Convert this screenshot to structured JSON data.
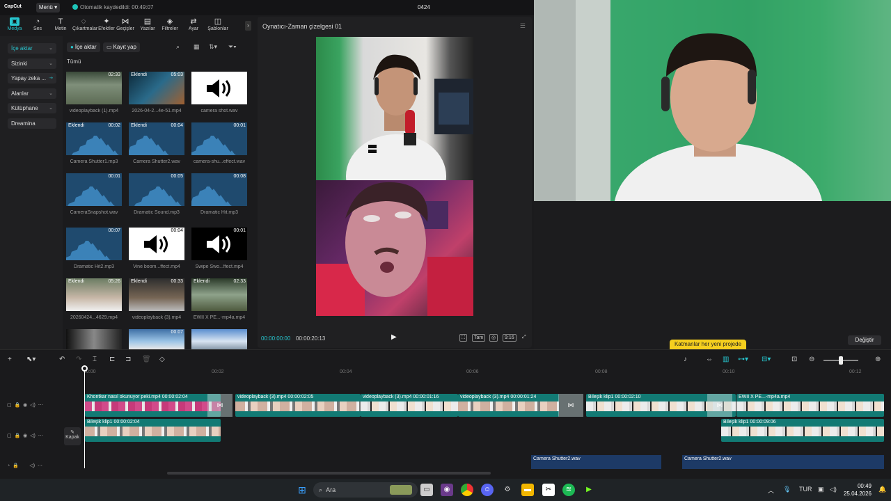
{
  "app": {
    "logo": "CapCut",
    "menu_label": "Menü",
    "autosave": "Otomatik kaydedildi: 00:49:07",
    "project_title": "0424"
  },
  "toolbar": {
    "items": [
      {
        "label": "Medya",
        "icon": "media-icon",
        "glyph": "▣"
      },
      {
        "label": "Ses",
        "icon": "audio-icon",
        "glyph": "◔"
      },
      {
        "label": "Metin",
        "icon": "text-icon",
        "glyph": "T"
      },
      {
        "label": "Çıkartmalar",
        "icon": "sticker-icon",
        "glyph": "◌"
      },
      {
        "label": "Efektler",
        "icon": "effects-icon",
        "glyph": "✦"
      },
      {
        "label": "Geçişler",
        "icon": "transitions-icon",
        "glyph": "⋈"
      },
      {
        "label": "Yazılar",
        "icon": "captions-icon",
        "glyph": "▤"
      },
      {
        "label": "Filtreler",
        "icon": "filters-icon",
        "glyph": "◈"
      },
      {
        "label": "Ayar",
        "icon": "adjust-icon",
        "glyph": "⇄"
      },
      {
        "label": "Şablonlar",
        "icon": "templates-icon",
        "glyph": "◫"
      }
    ]
  },
  "leftnav": {
    "items": [
      {
        "label": "İçe aktar"
      },
      {
        "label": "Sizinki"
      },
      {
        "label": "Yapay zeka ..."
      },
      {
        "label": "Alanlar"
      },
      {
        "label": "Kütüphane"
      },
      {
        "label": "Dreamina"
      }
    ]
  },
  "media": {
    "import_label": "İçe aktar",
    "record_label": "Kayıt yap",
    "all_label": "Tümü",
    "items": [
      {
        "name": "videoplayback (1).mp4",
        "duration": "02:33",
        "tag": "",
        "kind": "video1"
      },
      {
        "name": "2026-04-2...4e-51.mp4",
        "duration": "05:03",
        "tag": "Eklendi",
        "kind": "video2"
      },
      {
        "name": "camera shot.wav",
        "duration": "",
        "tag": "",
        "kind": "spk"
      },
      {
        "name": "Camera Shutter1.mp3",
        "duration": "00:02",
        "tag": "Eklendi",
        "kind": "wave"
      },
      {
        "name": "Camera Shutter2.wav",
        "duration": "00:04",
        "tag": "Eklendi",
        "kind": "wave"
      },
      {
        "name": "camera-shu...effect.wav",
        "duration": "00:01",
        "tag": "",
        "kind": "wave"
      },
      {
        "name": "CameraSnapshot.wav",
        "duration": "00:01",
        "tag": "",
        "kind": "wave"
      },
      {
        "name": "Dramatic Sound.mp3",
        "duration": "00:05",
        "tag": "",
        "kind": "wave"
      },
      {
        "name": "Dramatic Hit.mp3",
        "duration": "00:08",
        "tag": "",
        "kind": "wave"
      },
      {
        "name": "Dramatic Hit2.mp3",
        "duration": "00:07",
        "tag": "",
        "kind": "wave"
      },
      {
        "name": "Vine boom...ffect.mp4",
        "duration": "00:04",
        "tag": "",
        "kind": "spk"
      },
      {
        "name": "Swipe Swo...ffect.mp4",
        "duration": "00:01",
        "tag": "",
        "kind": "spkblack"
      },
      {
        "name": "20260424...4629.mp4",
        "duration": "05:26",
        "tag": "Eklendi",
        "kind": "people"
      },
      {
        "name": "videoplayback (3).mp4",
        "duration": "00:33",
        "tag": "Eklendi",
        "kind": "person2"
      },
      {
        "name": "EWII X PE...-mp4a.mp4",
        "duration": "02:33",
        "tag": "Eklendi",
        "kind": "land"
      },
      {
        "name": "",
        "duration": "",
        "tag": "",
        "kind": "bw"
      },
      {
        "name": "",
        "duration": "00:07",
        "tag": "",
        "kind": "sky"
      },
      {
        "name": "",
        "duration": "",
        "tag": "",
        "kind": "build"
      }
    ]
  },
  "player": {
    "title": "Oynatıcı-Zaman çizelgesi 01",
    "current_time": "00:00:00:00",
    "total_time": "00:00:20:13",
    "full_label": "Tam",
    "ratio_label": "9:16"
  },
  "right_panel": {
    "change_label": "Değiştir",
    "tooltip": "Katmanlar her yeni projede"
  },
  "timeline": {
    "ticks": [
      "00:00",
      "00:02",
      "00:04",
      "00:06",
      "00:08",
      "00:10",
      "00:12"
    ],
    "cover_label": "Kapak",
    "track1": [
      {
        "label": "Khontkar nasıl okunuyor peki.mp4   00:00:02:04"
      },
      {
        "label": "videoplayback (3).mp4   00:00:02:05"
      },
      {
        "label": "videoplayback (3).mp4   00:00:01:16"
      },
      {
        "label": "videoplayback (3).mp4   00:00:01:24"
      },
      {
        "label": "Bileşik klip1   00:00:02:10"
      },
      {
        "label": "EWII X PE...-mp4a.mp4"
      }
    ],
    "track2": [
      {
        "label": "Bileşik klip1   00:00:02:04"
      },
      {
        "label": "Bileşik klip1   00:00:09:06"
      }
    ],
    "audio": [
      {
        "label": "Camera Shutter2.wav"
      },
      {
        "label": "Camera Shutter2.wav"
      }
    ]
  },
  "taskbar": {
    "search_placeholder": "Ara",
    "lang": "TUR",
    "time": "00:49",
    "date": "25.04.2026"
  }
}
